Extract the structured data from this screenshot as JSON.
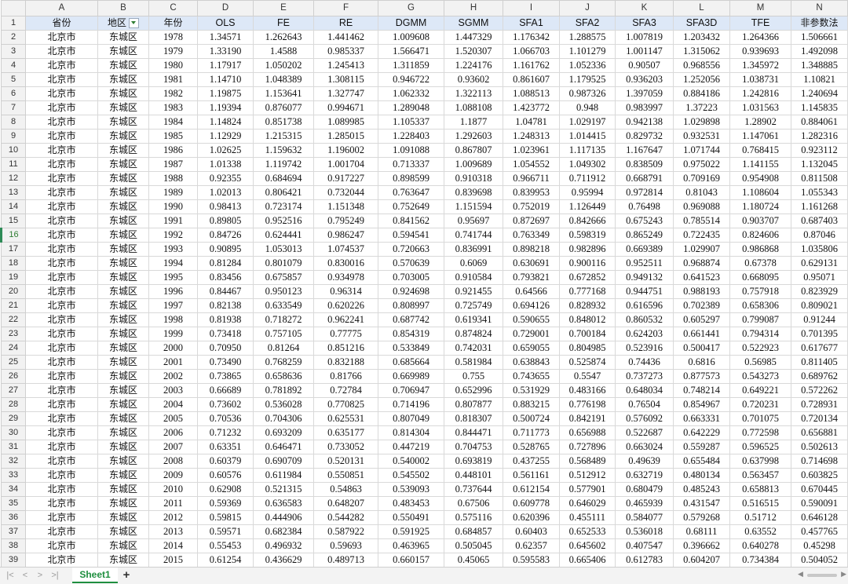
{
  "columns": [
    "A",
    "B",
    "C",
    "D",
    "E",
    "F",
    "G",
    "H",
    "I",
    "J",
    "K",
    "L",
    "M",
    "N"
  ],
  "headers": [
    "省份",
    "地区",
    "年份",
    "OLS",
    "FE",
    "RE",
    "DGMM",
    "SGMM",
    "SFA1",
    "SFA2",
    "SFA3",
    "SFA3D",
    "TFE",
    "非参数法"
  ],
  "active_row": 16,
  "rows": [
    [
      "北京市",
      "东城区",
      "1978",
      "1.34571",
      "1.262643",
      "1.441462",
      "1.009608",
      "1.447329",
      "1.176342",
      "1.288575",
      "1.007819",
      "1.203432",
      "1.264366",
      "1.506661"
    ],
    [
      "北京市",
      "东城区",
      "1979",
      "1.33190",
      "1.4588",
      "0.985337",
      "1.566471",
      "1.520307",
      "1.066703",
      "1.101279",
      "1.001147",
      "1.315062",
      "0.939693",
      "1.492098"
    ],
    [
      "北京市",
      "东城区",
      "1980",
      "1.17917",
      "1.050202",
      "1.245413",
      "1.311859",
      "1.224176",
      "1.161762",
      "1.052336",
      "0.90507",
      "0.968556",
      "1.345972",
      "1.348885"
    ],
    [
      "北京市",
      "东城区",
      "1981",
      "1.14710",
      "1.048389",
      "1.308115",
      "0.946722",
      "0.93602",
      "0.861607",
      "1.179525",
      "0.936203",
      "1.252056",
      "1.038731",
      "1.10821"
    ],
    [
      "北京市",
      "东城区",
      "1982",
      "1.19875",
      "1.153641",
      "1.327747",
      "1.062332",
      "1.322113",
      "1.088513",
      "0.987326",
      "1.397059",
      "0.884186",
      "1.242816",
      "1.240694"
    ],
    [
      "北京市",
      "东城区",
      "1983",
      "1.19394",
      "0.876077",
      "0.994671",
      "1.289048",
      "1.088108",
      "1.423772",
      "0.948",
      "0.983997",
      "1.37223",
      "1.031563",
      "1.145835"
    ],
    [
      "北京市",
      "东城区",
      "1984",
      "1.14824",
      "0.851738",
      "1.089985",
      "1.105337",
      "1.1877",
      "1.04781",
      "1.029197",
      "0.942138",
      "1.029898",
      "1.28902",
      "0.884061"
    ],
    [
      "北京市",
      "东城区",
      "1985",
      "1.12929",
      "1.215315",
      "1.285015",
      "1.228403",
      "1.292603",
      "1.248313",
      "1.014415",
      "0.829732",
      "0.932531",
      "1.147061",
      "1.282316"
    ],
    [
      "北京市",
      "东城区",
      "1986",
      "1.02625",
      "1.159632",
      "1.196002",
      "1.091088",
      "0.867807",
      "1.023961",
      "1.117135",
      "1.167647",
      "1.071744",
      "0.768415",
      "0.923112"
    ],
    [
      "北京市",
      "东城区",
      "1987",
      "1.01338",
      "1.119742",
      "1.001704",
      "0.713337",
      "1.009689",
      "1.054552",
      "1.049302",
      "0.838509",
      "0.975022",
      "1.141155",
      "1.132045"
    ],
    [
      "北京市",
      "东城区",
      "1988",
      "0.92355",
      "0.684694",
      "0.917227",
      "0.898599",
      "0.910318",
      "0.966711",
      "0.711912",
      "0.668791",
      "0.709169",
      "0.954908",
      "0.811508"
    ],
    [
      "北京市",
      "东城区",
      "1989",
      "1.02013",
      "0.806421",
      "0.732044",
      "0.763647",
      "0.839698",
      "0.839953",
      "0.95994",
      "0.972814",
      "0.81043",
      "1.108604",
      "1.055343"
    ],
    [
      "北京市",
      "东城区",
      "1990",
      "0.98413",
      "0.723174",
      "1.151348",
      "0.752649",
      "1.151594",
      "0.752019",
      "1.126449",
      "0.76498",
      "0.969088",
      "1.180724",
      "1.161268"
    ],
    [
      "北京市",
      "东城区",
      "1991",
      "0.89805",
      "0.952516",
      "0.795249",
      "0.841562",
      "0.95697",
      "0.872697",
      "0.842666",
      "0.675243",
      "0.785514",
      "0.903707",
      "0.687403"
    ],
    [
      "北京市",
      "东城区",
      "1992",
      "0.84726",
      "0.624441",
      "0.986247",
      "0.594541",
      "0.741744",
      "0.763349",
      "0.598319",
      "0.865249",
      "0.722435",
      "0.824606",
      "0.87046"
    ],
    [
      "北京市",
      "东城区",
      "1993",
      "0.90895",
      "1.053013",
      "1.074537",
      "0.720663",
      "0.836991",
      "0.898218",
      "0.982896",
      "0.669389",
      "1.029907",
      "0.986868",
      "1.035806"
    ],
    [
      "北京市",
      "东城区",
      "1994",
      "0.81284",
      "0.801079",
      "0.830016",
      "0.570639",
      "0.6069",
      "0.630691",
      "0.900116",
      "0.952511",
      "0.968874",
      "0.67378",
      "0.629131"
    ],
    [
      "北京市",
      "东城区",
      "1995",
      "0.83456",
      "0.675857",
      "0.934978",
      "0.703005",
      "0.910584",
      "0.793821",
      "0.672852",
      "0.949132",
      "0.641523",
      "0.668095",
      "0.95071"
    ],
    [
      "北京市",
      "东城区",
      "1996",
      "0.84467",
      "0.950123",
      "0.96314",
      "0.924698",
      "0.921455",
      "0.64566",
      "0.777168",
      "0.944751",
      "0.988193",
      "0.757918",
      "0.823929"
    ],
    [
      "北京市",
      "东城区",
      "1997",
      "0.82138",
      "0.633549",
      "0.620226",
      "0.808997",
      "0.725749",
      "0.694126",
      "0.828932",
      "0.616596",
      "0.702389",
      "0.658306",
      "0.809021"
    ],
    [
      "北京市",
      "东城区",
      "1998",
      "0.81938",
      "0.718272",
      "0.962241",
      "0.687742",
      "0.619341",
      "0.590655",
      "0.848012",
      "0.860532",
      "0.605297",
      "0.799087",
      "0.91244"
    ],
    [
      "北京市",
      "东城区",
      "1999",
      "0.73418",
      "0.757105",
      "0.77775",
      "0.854319",
      "0.874824",
      "0.729001",
      "0.700184",
      "0.624203",
      "0.661441",
      "0.794314",
      "0.701395"
    ],
    [
      "北京市",
      "东城区",
      "2000",
      "0.70950",
      "0.81264",
      "0.851216",
      "0.533849",
      "0.742031",
      "0.659055",
      "0.804985",
      "0.523916",
      "0.500417",
      "0.522923",
      "0.617677"
    ],
    [
      "北京市",
      "东城区",
      "2001",
      "0.73490",
      "0.768259",
      "0.832188",
      "0.685664",
      "0.581984",
      "0.638843",
      "0.525874",
      "0.74436",
      "0.6816",
      "0.56985",
      "0.811405"
    ],
    [
      "北京市",
      "东城区",
      "2002",
      "0.73865",
      "0.658636",
      "0.81766",
      "0.669989",
      "0.755",
      "0.743655",
      "0.5547",
      "0.737273",
      "0.877573",
      "0.543273",
      "0.689762"
    ],
    [
      "北京市",
      "东城区",
      "2003",
      "0.66689",
      "0.781892",
      "0.72784",
      "0.706947",
      "0.652996",
      "0.531929",
      "0.483166",
      "0.648034",
      "0.748214",
      "0.649221",
      "0.572262"
    ],
    [
      "北京市",
      "东城区",
      "2004",
      "0.73602",
      "0.536028",
      "0.770825",
      "0.714196",
      "0.807877",
      "0.883215",
      "0.776198",
      "0.76504",
      "0.854967",
      "0.720231",
      "0.728931"
    ],
    [
      "北京市",
      "东城区",
      "2005",
      "0.70536",
      "0.704306",
      "0.625531",
      "0.807049",
      "0.818307",
      "0.500724",
      "0.842191",
      "0.576092",
      "0.663331",
      "0.701075",
      "0.720134"
    ],
    [
      "北京市",
      "东城区",
      "2006",
      "0.71232",
      "0.693209",
      "0.635177",
      "0.814304",
      "0.844471",
      "0.711773",
      "0.656988",
      "0.522687",
      "0.642229",
      "0.772598",
      "0.656881"
    ],
    [
      "北京市",
      "东城区",
      "2007",
      "0.63351",
      "0.646471",
      "0.733052",
      "0.447219",
      "0.704753",
      "0.528765",
      "0.727896",
      "0.663024",
      "0.559287",
      "0.596525",
      "0.502613"
    ],
    [
      "北京市",
      "东城区",
      "2008",
      "0.60379",
      "0.690709",
      "0.520131",
      "0.540002",
      "0.693819",
      "0.437255",
      "0.568489",
      "0.49639",
      "0.655484",
      "0.637998",
      "0.714698"
    ],
    [
      "北京市",
      "东城区",
      "2009",
      "0.60576",
      "0.611984",
      "0.550851",
      "0.545502",
      "0.448101",
      "0.561161",
      "0.512912",
      "0.632719",
      "0.480134",
      "0.563457",
      "0.603825"
    ],
    [
      "北京市",
      "东城区",
      "2010",
      "0.62908",
      "0.521315",
      "0.54863",
      "0.539093",
      "0.737644",
      "0.612154",
      "0.577901",
      "0.680479",
      "0.485243",
      "0.658813",
      "0.670445"
    ],
    [
      "北京市",
      "东城区",
      "2011",
      "0.59369",
      "0.636583",
      "0.648207",
      "0.483453",
      "0.67506",
      "0.609778",
      "0.646029",
      "0.465939",
      "0.431547",
      "0.516515",
      "0.590091"
    ],
    [
      "北京市",
      "东城区",
      "2012",
      "0.59815",
      "0.444906",
      "0.544282",
      "0.550491",
      "0.575116",
      "0.620396",
      "0.455111",
      "0.584077",
      "0.579268",
      "0.51712",
      "0.646128"
    ],
    [
      "北京市",
      "东城区",
      "2013",
      "0.59571",
      "0.682384",
      "0.587922",
      "0.591925",
      "0.684857",
      "0.60403",
      "0.652533",
      "0.536018",
      "0.68111",
      "0.63552",
      "0.457765"
    ],
    [
      "北京市",
      "东城区",
      "2014",
      "0.55453",
      "0.496932",
      "0.59693",
      "0.463965",
      "0.505045",
      "0.62357",
      "0.645602",
      "0.407547",
      "0.396662",
      "0.640278",
      "0.45298"
    ],
    [
      "北京市",
      "东城区",
      "2015",
      "0.61254",
      "0.436629",
      "0.489713",
      "0.660157",
      "0.45065",
      "0.595583",
      "0.665406",
      "0.612783",
      "0.604207",
      "0.734384",
      "0.504052"
    ]
  ],
  "sheet_tab": "Sheet1",
  "add_sheet_label": "+",
  "nav": {
    "first": "|<",
    "prev": "<",
    "next": ">",
    "last": ">|"
  },
  "scroll": {
    "left": "◀",
    "right": "▶"
  }
}
